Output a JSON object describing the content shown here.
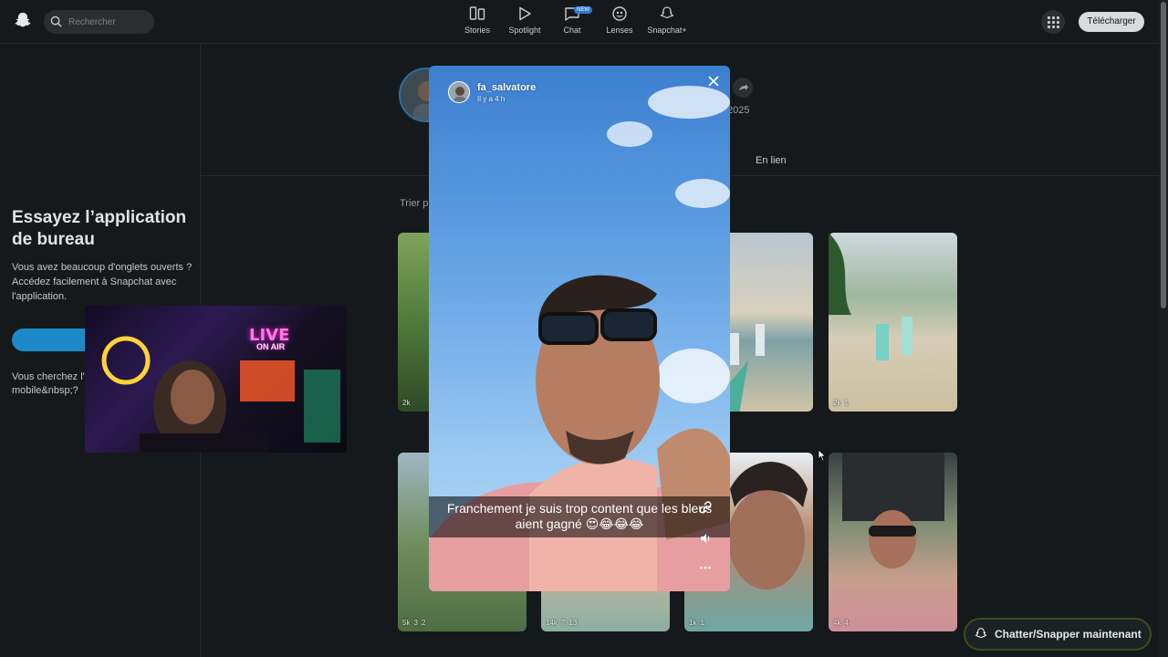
{
  "header": {
    "search_placeholder": "Rechercher",
    "nav": [
      {
        "label": "Stories",
        "icon": "stories-icon"
      },
      {
        "label": "Spotlight",
        "icon": "spotlight-icon"
      },
      {
        "label": "Chat",
        "icon": "chat-icon",
        "badge": "NEW"
      },
      {
        "label": "Lenses",
        "icon": "lenses-icon"
      },
      {
        "label": "Snapchat+",
        "icon": "snapchat-plus-icon"
      }
    ],
    "download_label": "Télécharger"
  },
  "promo": {
    "title": "Essayez l’application de bureau",
    "body": "Vous avez beaucoup d'onglets ouverts ? Accédez facilement à Snapchat avec l'application.",
    "footer": "Vous cherchez l'application mobile&nbsp;?"
  },
  "profile": {
    "year": "2025",
    "tab": "En lien",
    "sort_label": "Trier p"
  },
  "tiles": [
    {
      "views": "2k",
      "shares": "",
      "comments": ""
    },
    {
      "views": "",
      "shares": "",
      "comments": ""
    },
    {
      "views": "",
      "shares": "",
      "comments": ""
    },
    {
      "views": "2k",
      "shares": "1",
      "comments": ""
    },
    {
      "views": "5k",
      "shares": "3",
      "comments": "2"
    },
    {
      "views": "14k",
      "shares": "7",
      "comments": "13"
    },
    {
      "views": "1k",
      "shares": "1",
      "comments": ""
    },
    {
      "views": "4k",
      "shares": "",
      "comments": "4"
    }
  ],
  "story": {
    "username": "fa_salvatore",
    "time": "Il y a 4 h",
    "caption_line1": "Franchement je suis trop content que les bleus",
    "caption_line2": "aient gagné 😍😂😂😂"
  },
  "chat_cta": "Chatter/Snapper maintenant",
  "colors": {
    "background": "#16191b",
    "accent_blue": "#1d89c9",
    "download_button": "#d9dcde"
  }
}
